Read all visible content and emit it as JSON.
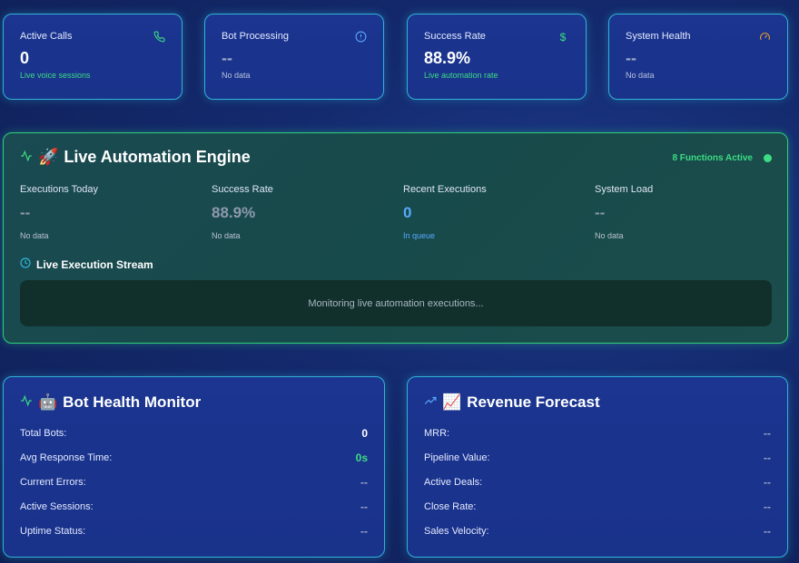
{
  "stats": [
    {
      "title": "Active Calls",
      "value": "0",
      "sub": "Live voice sessions",
      "icon": "phone-icon"
    },
    {
      "title": "Bot Processing",
      "value": "--",
      "sub": "No data",
      "icon": "info-icon"
    },
    {
      "title": "Success Rate",
      "value": "88.9%",
      "sub": "Live automation rate",
      "icon": "dollar-icon"
    },
    {
      "title": "System Health",
      "value": "--",
      "sub": "No data",
      "icon": "gauge-icon"
    }
  ],
  "engine": {
    "emoji": "🚀",
    "title": "Live Automation Engine",
    "badge": "8 Functions Active",
    "metrics": [
      {
        "label": "Executions Today",
        "value": "--",
        "sub": "No data"
      },
      {
        "label": "Success Rate",
        "value": "88.9%",
        "sub": "No data"
      },
      {
        "label": "Recent Executions",
        "value": "0",
        "sub": "In queue"
      },
      {
        "label": "System Load",
        "value": "--",
        "sub": "No data"
      }
    ],
    "stream_title": "Live Execution Stream",
    "stream_message": "Monitoring live automation executions..."
  },
  "bot_health": {
    "emoji": "🤖",
    "title": "Bot Health Monitor",
    "rows": [
      {
        "label": "Total Bots:",
        "value": "0"
      },
      {
        "label": "Avg Response Time:",
        "value": "0s"
      },
      {
        "label": "Current Errors:",
        "value": "--"
      },
      {
        "label": "Active Sessions:",
        "value": "--"
      },
      {
        "label": "Uptime Status:",
        "value": "--"
      }
    ]
  },
  "revenue": {
    "emoji": "📈",
    "title": "Revenue Forecast",
    "rows": [
      {
        "label": "MRR:",
        "value": "--"
      },
      {
        "label": "Pipeline Value:",
        "value": "--"
      },
      {
        "label": "Active Deals:",
        "value": "--"
      },
      {
        "label": "Close Rate:",
        "value": "--"
      },
      {
        "label": "Sales Velocity:",
        "value": "--"
      }
    ]
  },
  "colors": {
    "accent_cyan": "#2fb3d8",
    "accent_green": "#3ddc84",
    "accent_blue": "#5aa8ff"
  }
}
